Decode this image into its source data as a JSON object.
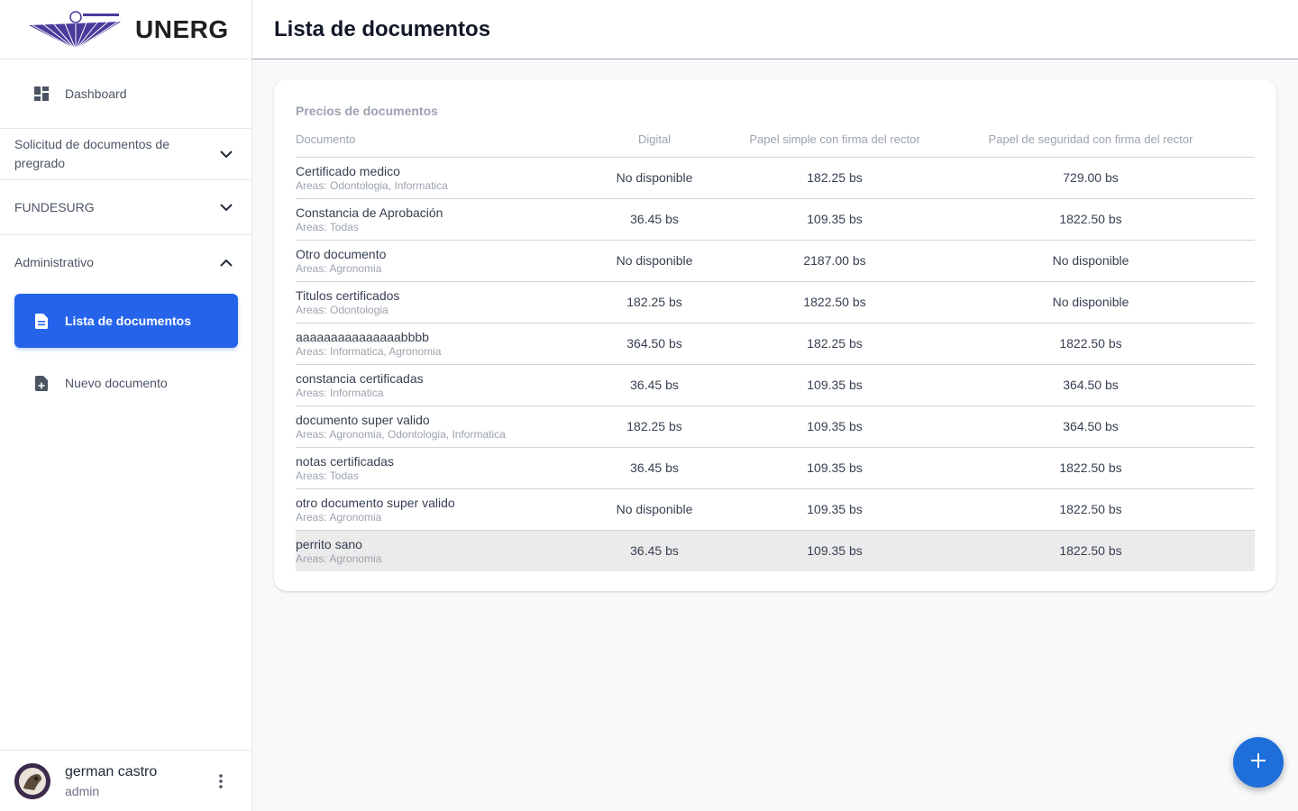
{
  "brand": {
    "name": "UNERG"
  },
  "sidebar": {
    "dashboard": "Dashboard",
    "sections": [
      {
        "label": "Solicitud de documentos de pregrado",
        "expanded": false
      },
      {
        "label": "FUNDESURG",
        "expanded": false
      },
      {
        "label": "Administrativo",
        "expanded": true
      }
    ],
    "sub_items": [
      {
        "label": "Lista de documentos",
        "active": true
      },
      {
        "label": "Nuevo documento",
        "active": false
      }
    ]
  },
  "user": {
    "name": "german castro",
    "role": "admin"
  },
  "header": {
    "title": "Lista de documentos"
  },
  "card": {
    "title": "Precios de documentos",
    "columns": [
      "Documento",
      "Digital",
      "Papel simple con firma del rector",
      "Papel de seguridad con firma del rector"
    ],
    "rows": [
      {
        "name": "Certificado medico",
        "areas": "Areas: Odontologia, Informatica",
        "digital": "No disponible",
        "simple": "182.25 bs",
        "seguridad": "729.00 bs"
      },
      {
        "name": "Constancia de Aprobación",
        "areas": "Areas: Todas",
        "digital": "36.45 bs",
        "simple": "109.35 bs",
        "seguridad": "1822.50 bs"
      },
      {
        "name": "Otro documento",
        "areas": "Areas: Agronomia",
        "digital": "No disponible",
        "simple": "2187.00 bs",
        "seguridad": "No disponible"
      },
      {
        "name": "Titulos certificados",
        "areas": "Areas: Odontologia",
        "digital": "182.25 bs",
        "simple": "1822.50 bs",
        "seguridad": "No disponible"
      },
      {
        "name": "aaaaaaaaaaaaaaabbbb",
        "areas": "Areas: Informatica, Agronomia",
        "digital": "364.50 bs",
        "simple": "182.25 bs",
        "seguridad": "1822.50 bs"
      },
      {
        "name": "constancia certificadas",
        "areas": "Areas: Informatica",
        "digital": "36.45 bs",
        "simple": "109.35 bs",
        "seguridad": "364.50 bs"
      },
      {
        "name": "documento super valido",
        "areas": "Areas: Agronomia, Odontologia, Informatica",
        "digital": "182.25 bs",
        "simple": "109.35 bs",
        "seguridad": "364.50 bs"
      },
      {
        "name": "notas certificadas",
        "areas": "Areas: Todas",
        "digital": "36.45 bs",
        "simple": "109.35 bs",
        "seguridad": "1822.50 bs"
      },
      {
        "name": "otro documento super valido",
        "areas": "Areas: Agronomia",
        "digital": "No disponible",
        "simple": "109.35 bs",
        "seguridad": "1822.50 bs"
      },
      {
        "name": "perrito sano",
        "areas": "Areas: Agronomia",
        "digital": "36.45 bs",
        "simple": "109.35 bs",
        "seguridad": "1822.50 bs",
        "highlighted": true
      }
    ]
  },
  "colors": {
    "accent": "#2563eb",
    "fab": "#1e6fd9",
    "logo": "#4b3a9c"
  },
  "icons": [
    "dashboard-icon",
    "chevron-down-icon",
    "chevron-up-icon",
    "document-icon",
    "add-document-icon",
    "more-vertical-icon",
    "plus-icon"
  ]
}
